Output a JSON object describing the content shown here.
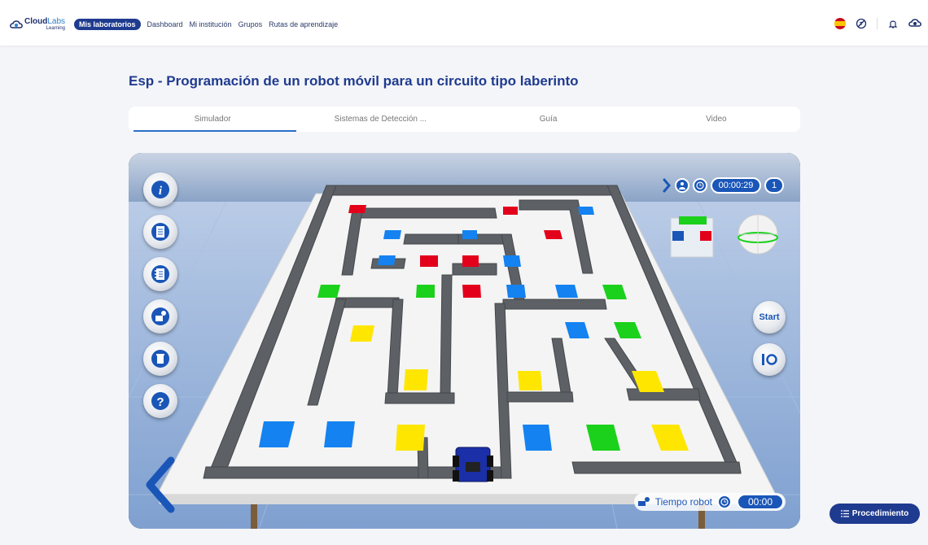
{
  "logo": {
    "brand_bold": "Cloud",
    "brand_light": "Labs",
    "sub": "Learning"
  },
  "nav": {
    "items": [
      {
        "label": "Mis laboratorios",
        "active": true
      },
      {
        "label": "Dashboard",
        "active": false
      },
      {
        "label": "Mi institución",
        "active": false
      },
      {
        "label": "Grupos",
        "active": false
      },
      {
        "label": "Rutas de aprendizaje",
        "active": false
      }
    ],
    "icons": [
      "spain-flag-icon",
      "no-accessibility-icon",
      "bell-icon",
      "user-menu-icon"
    ]
  },
  "page": {
    "title": "Esp - Programación de un robot móvil para un circuito tipo laberinto"
  },
  "tabs": [
    {
      "label": "Simulador",
      "active": true
    },
    {
      "label": "Sistemas de Detección ...",
      "active": false
    },
    {
      "label": "Guía",
      "active": false
    },
    {
      "label": "Video",
      "active": false
    }
  ],
  "simulator": {
    "left_tools": [
      "info-icon",
      "document-icon",
      "notebook-icon",
      "robot-config-icon",
      "trash-icon",
      "help-icon"
    ],
    "hud": {
      "elapsed": "00:00:29",
      "counter": "1"
    },
    "start_label": "Start",
    "robot_time_label": "Tiempo robot",
    "robot_time": "00:00",
    "colors": {
      "accent": "#1a56b8",
      "wall": "#5d6166",
      "floor": "#f4f4f4",
      "red": "#e3001b",
      "blue": "#1482f0",
      "green": "#1bd11b",
      "yellow": "#ffe600"
    }
  },
  "procedure_button": {
    "label": "Procedimiento"
  }
}
